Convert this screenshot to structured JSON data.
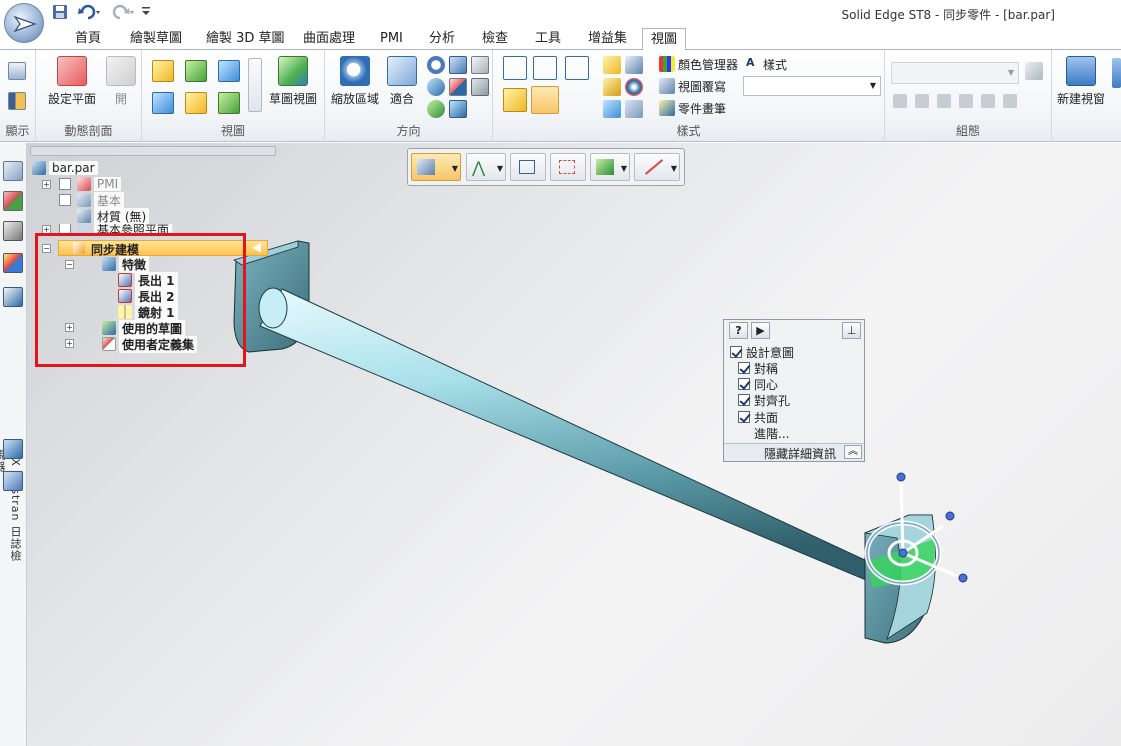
{
  "window": {
    "title": "Solid Edge ST8 - 同步零件 - [bar.par]"
  },
  "tabs": [
    "首頁",
    "繪製草圖",
    "繪製 3D 草圖",
    "曲面處理",
    "PMI",
    "分析",
    "檢查",
    "工具",
    "增益集",
    "視圖"
  ],
  "active_tab": "視圖",
  "ribbon": {
    "groups": {
      "display": "顯示",
      "dynamic_section": "動態剖面",
      "views": "視圖",
      "orient": "方向",
      "style": "樣式",
      "combination": "組態"
    },
    "buttons": {
      "set_plane": "設定平面",
      "open": "開",
      "sketch_view": "草圖視圖",
      "zoom_area": "縮放區域",
      "fit": "適合",
      "color_manager": "顏色管理器",
      "view_override": "視圖覆寫",
      "part_painter": "零件畫筆",
      "styles": "樣式",
      "new_window": "新建視窗"
    }
  },
  "side_tab": {
    "label": "NX Nastran 日誌檢視器"
  },
  "pathfinder": {
    "root": "bar.par",
    "items": {
      "pmi": "PMI",
      "base": "基本",
      "material": "材質 (無)",
      "ref_planes": "基本參照平面",
      "sync": "同步建模",
      "features": "特徵",
      "extrude1": "長出 1",
      "extrude2": "長出 2",
      "mirror1": "鏡射 1",
      "used_sketches": "使用的草圖",
      "user_sets": "使用者定義集"
    }
  },
  "design_intent": {
    "header": "設計意圖",
    "options": [
      "對稱",
      "同心",
      "對齊孔",
      "共面"
    ],
    "advanced": "進階...",
    "hide_details": "隱藏詳細資訊",
    "help": "?"
  },
  "colors": {
    "accent": "#f7c667",
    "highlight": "#e0161b",
    "model": "#9fd3dd"
  }
}
